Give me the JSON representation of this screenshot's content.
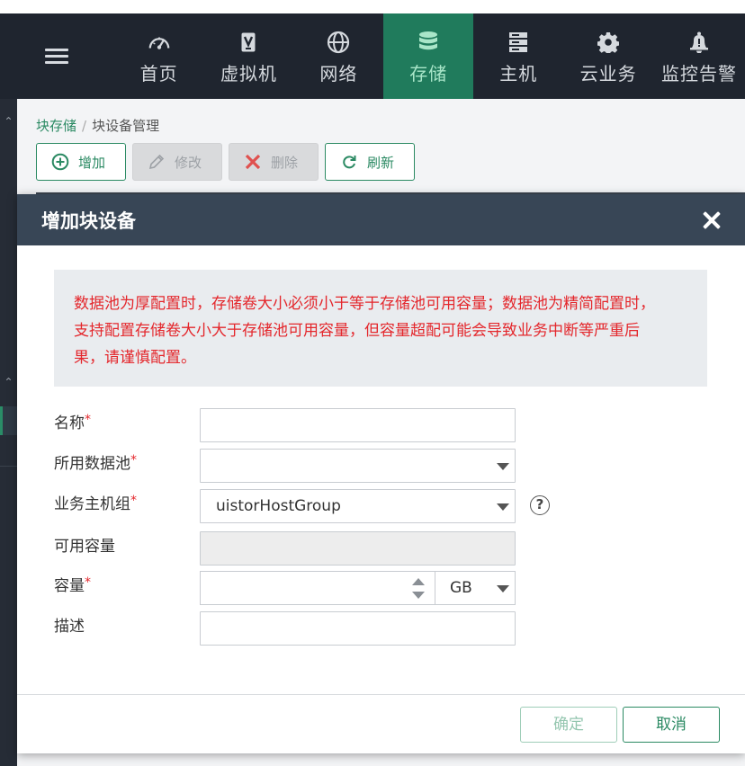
{
  "nav": {
    "items": [
      {
        "label": "首页",
        "icon": "dashboard-icon"
      },
      {
        "label": "虚拟机",
        "icon": "vm-icon"
      },
      {
        "label": "网络",
        "icon": "globe-icon"
      },
      {
        "label": "存储",
        "icon": "database-icon",
        "active": true
      },
      {
        "label": "主机",
        "icon": "server-icon"
      },
      {
        "label": "云业务",
        "icon": "gear-icon"
      },
      {
        "label": "监控告警",
        "icon": "bell-icon"
      }
    ]
  },
  "breadcrumb": {
    "root": "块存储",
    "separator": "/",
    "current": "块设备管理"
  },
  "toolbar": {
    "add": "增加",
    "edit": "修改",
    "delete": "删除",
    "refresh": "刷新"
  },
  "modal": {
    "title": "增加块设备",
    "warning_lines": [
      "数据池为厚配置时，存储卷大小必须小于等于存储池可用容量；数据池为精简配置时，",
      "支持配置存储卷大小大于存储池可用容量，但容量超配可能会导致业务中断等严重后",
      "果，请谨慎配置。"
    ],
    "form": {
      "name_label": "名称",
      "pool_label": "所用数据池",
      "host_group_label": "业务主机组",
      "host_group_value": "uistorHostGroup",
      "available_label": "可用容量",
      "capacity_label": "容量",
      "capacity_unit": "GB",
      "desc_label": "描述",
      "required_mark": "*",
      "help": "?"
    },
    "confirm": "确定",
    "cancel": "取消"
  },
  "colors": {
    "accent": "#2b8a63",
    "nav_bg": "#1f252f",
    "active_nav": "#207b5c",
    "modal_header": "#384656",
    "warning_text": "#e4272c"
  }
}
